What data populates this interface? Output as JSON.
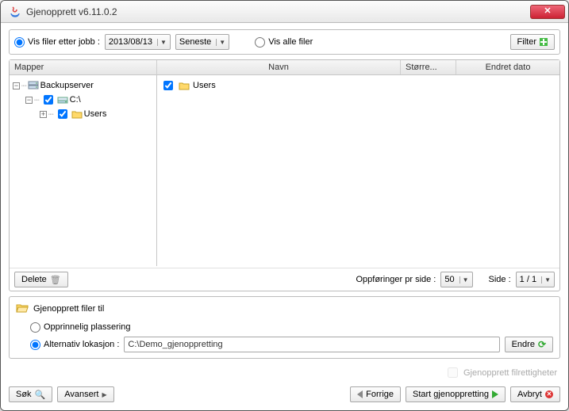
{
  "window": {
    "title": "Gjenopprett v6.11.0.2"
  },
  "topbar": {
    "byJobLabel": "Vis filer etter jobb :",
    "allFilesLabel": "Vis alle filer",
    "dateValue": "2013/08/13",
    "orderValue": "Seneste",
    "filterLabel": "Filter"
  },
  "headers": {
    "folders": "Mapper",
    "name": "Navn",
    "size": "Større...",
    "modified": "Endret dato"
  },
  "tree": {
    "root": "Backupserver",
    "drive": "C:\\",
    "users": "Users"
  },
  "list": {
    "row0": {
      "name": "Users"
    }
  },
  "pager": {
    "deleteLabel": "Delete",
    "perPageLabel": "Oppføringer pr side :",
    "perPageValue": "50",
    "pageLabel": "Side :",
    "pageValue": "1 / 1"
  },
  "dest": {
    "title": "Gjenopprett filer til",
    "original": "Opprinnelig plassering",
    "altLabel": "Alternativ lokasjon :",
    "path": "C:\\Demo_gjenoppretting",
    "changeLabel": "Endre"
  },
  "rights": {
    "label": "Gjenopprett filrettigheter"
  },
  "bottom": {
    "search": "Søk",
    "advanced": "Avansert",
    "prev": "Forrige",
    "start": "Start gjenoppretting",
    "cancel": "Avbryt"
  }
}
